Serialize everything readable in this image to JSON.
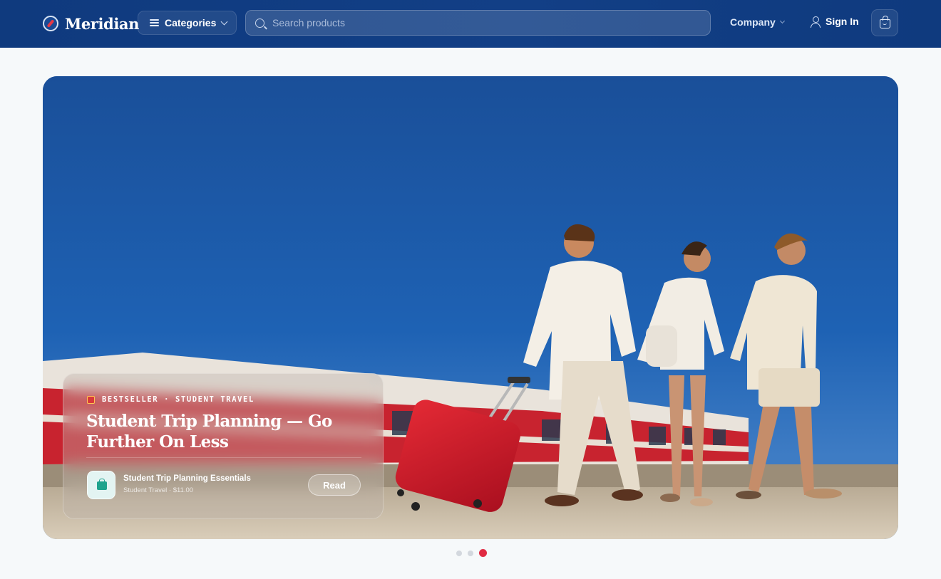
{
  "brand": {
    "name": "Meridian",
    "icon": "compass-icon"
  },
  "nav": {
    "categories_label": "Categories",
    "search_placeholder": "Search products",
    "company_label": "Company",
    "signin_label": "Sign In",
    "cart_icon": "shopping-bag-icon"
  },
  "hero": {
    "eyebrow": "BESTSELLER · STUDENT TRAVEL",
    "title": "Student Trip Planning — Go Further On Less",
    "product": {
      "name": "Student Trip Planning Essentials",
      "meta": "Student Travel · $11.00"
    },
    "cta_label": "Read"
  },
  "carousel": {
    "count": 3,
    "active": 3
  },
  "colors": {
    "header": "#123f86",
    "accent": "#e02b42",
    "thumb": "#1fa38d"
  }
}
